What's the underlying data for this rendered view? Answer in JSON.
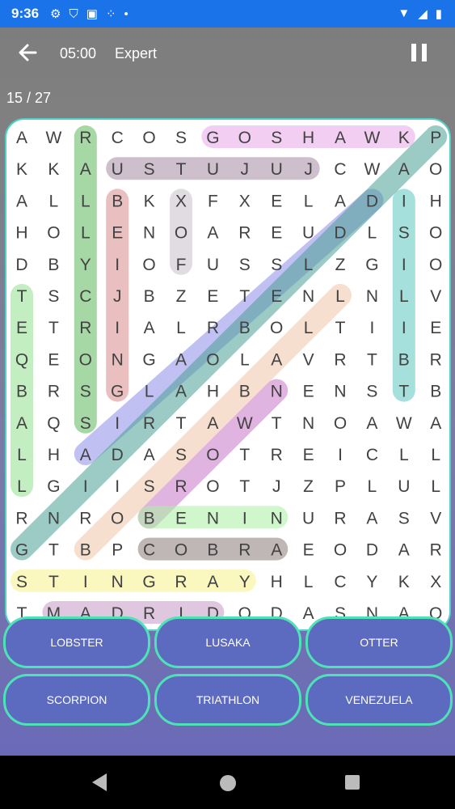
{
  "status_bar": {
    "time": "9:36"
  },
  "header": {
    "back_icon": "arrow-left-icon",
    "timer": "05:00",
    "level": "Expert",
    "pause_icon": "pause-icon"
  },
  "progress": "15 / 27",
  "grid": [
    "AWRCOSGOSHAWKP",
    "KKAUSTUJUJCWAO",
    "ALLBKXFXELADIH",
    "HOLENOAREUDLSO",
    "DBYIOFUSSLZGIO",
    "TSCJBZETENLNLV",
    "ETRIALRBOLTIIE",
    "QEONGAOLAVRTBR",
    "BRSGLAHBNENSTB",
    "AQSIRTAWTNOAWA",
    "LHADASOTREICLL",
    "LGIISROTJZPLUL",
    "RNROBENINURASV",
    "GTBPCOBRAEODAR",
    "STINGRAYHLCYKX",
    "TMADRIDODASNAQ"
  ],
  "found_words": [
    {
      "r1": 0,
      "c1": 6,
      "r2": 0,
      "c2": 12,
      "color": "#e8a6ea"
    },
    {
      "r1": 1,
      "c1": 3,
      "r2": 1,
      "c2": 9,
      "color": "#a48ba0"
    },
    {
      "r1": 0,
      "c1": 2,
      "r2": 9,
      "c2": 2,
      "color": "#5cb85c"
    },
    {
      "r1": 2,
      "c1": 3,
      "r2": 8,
      "c2": 3,
      "color": "#d88a8a"
    },
    {
      "r1": 2,
      "c1": 5,
      "r2": 4,
      "c2": 5,
      "color": "#c7c0c8"
    },
    {
      "r1": 2,
      "c1": 12,
      "r2": 8,
      "c2": 12,
      "color": "#5cc6c0"
    },
    {
      "r1": 5,
      "c1": 0,
      "r2": 11,
      "c2": 0,
      "color": "#8fe08f"
    },
    {
      "r1": 2,
      "c1": 11,
      "r2": 10,
      "c2": 2,
      "color": "#8c8ce8"
    },
    {
      "r1": 0,
      "c1": 13,
      "r2": 13,
      "c2": 0,
      "color": "#4a9e96"
    },
    {
      "r1": 5,
      "c1": 10,
      "r2": 13,
      "c2": 2,
      "color": "#f0c4a8"
    },
    {
      "r1": 8,
      "c1": 8,
      "r2": 12,
      "c2": 4,
      "color": "#c774c7"
    },
    {
      "r1": 12,
      "c1": 4,
      "r2": 12,
      "c2": 8,
      "color": "#aaf0a0"
    },
    {
      "r1": 13,
      "c1": 4,
      "r2": 13,
      "c2": 8,
      "color": "#8a7a7a"
    },
    {
      "r1": 14,
      "c1": 0,
      "r2": 14,
      "c2": 7,
      "color": "#f6f08a"
    },
    {
      "r1": 15,
      "c1": 1,
      "r2": 15,
      "c2": 6,
      "color": "#c49ac4"
    }
  ],
  "word_list": [
    {
      "label": "LOBSTER",
      "found": false
    },
    {
      "label": "LUSAKA",
      "found": false
    },
    {
      "label": "OTTER",
      "found": false
    },
    {
      "label": "SCORPION",
      "found": false
    },
    {
      "label": "TRIATHLON",
      "found": false
    },
    {
      "label": "VENEZUELA",
      "found": false
    }
  ]
}
